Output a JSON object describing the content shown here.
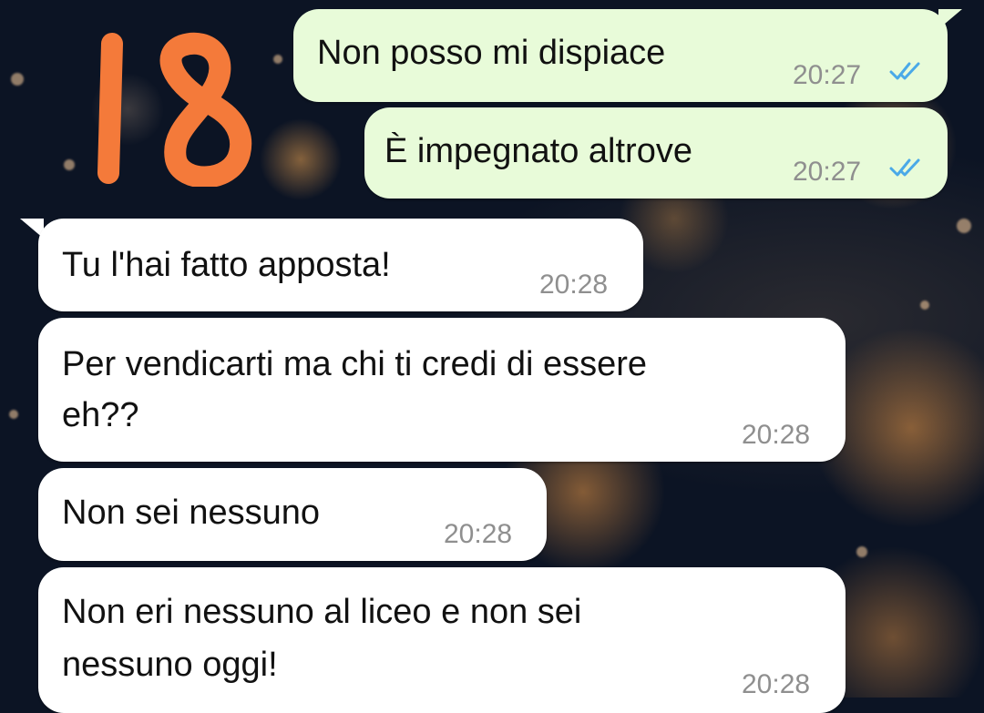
{
  "sticker": {
    "text": "18",
    "color": "#f47a3a"
  },
  "colors": {
    "outgoing_bubble": "#e8fbd9",
    "incoming_bubble": "#ffffff",
    "read_ticks": "#4aa9e8"
  },
  "messages": [
    {
      "direction": "outgoing",
      "text": "Non posso mi dispiace",
      "time": "20:27",
      "status_icon": "double-check-read-icon"
    },
    {
      "direction": "outgoing",
      "text": "È impegnato altrove",
      "time": "20:27",
      "status_icon": "double-check-read-icon"
    },
    {
      "direction": "incoming",
      "text": "Tu l'hai fatto apposta!",
      "time": "20:28"
    },
    {
      "direction": "incoming",
      "line1": "Per vendicarti ma chi ti credi di essere",
      "line2": "eh??",
      "time": "20:28"
    },
    {
      "direction": "incoming",
      "text": "Non sei nessuno",
      "time": "20:28"
    },
    {
      "direction": "incoming",
      "line1": "Non eri nessuno al liceo e non sei",
      "line2": "nessuno oggi!",
      "time": "20:28"
    }
  ]
}
